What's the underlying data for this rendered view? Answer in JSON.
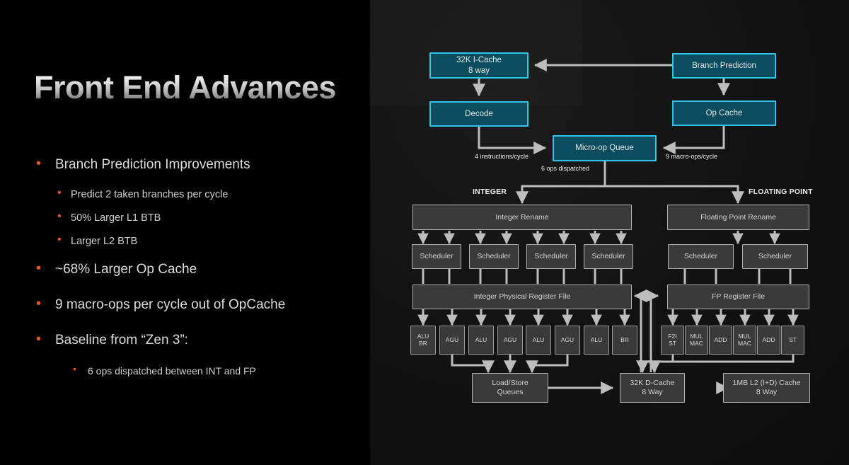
{
  "slide": {
    "title": "Front End Advances",
    "accent_orange": "#e8571f",
    "accent_cyan": "#2ec4ec",
    "panel_background": "#000000",
    "diagram_background": "#131313"
  },
  "bullets": [
    {
      "level": 1,
      "text": "Branch Prediction Improvements"
    },
    {
      "level": 2,
      "text": "Predict 2 taken branches per cycle"
    },
    {
      "level": 2,
      "text": "50% Larger L1 BTB"
    },
    {
      "level": 2,
      "text": "Larger L2 BTB"
    },
    {
      "level": 1,
      "text": "~68% Larger Op Cache"
    },
    {
      "level": 1,
      "text": "9 macro-ops per cycle out of OpCache"
    },
    {
      "level": 1,
      "text": "Baseline from “Zen 3”:"
    },
    {
      "level": 3,
      "text": "6 ops dispatched between INT and FP"
    }
  ],
  "diagram": {
    "frontend_boxes": {
      "icache_line1": "32K I-Cache",
      "icache_line2": "8 way",
      "decode": "Decode",
      "branch_prediction": "Branch Prediction",
      "op_cache": "Op Cache",
      "micro_op_queue": "Micro-op Queue"
    },
    "edge_labels": {
      "decode_rate": "4 instructions/cycle",
      "opcache_rate": "9 macro-ops/cycle",
      "dispatch_rate": "6 ops dispatched"
    },
    "section_labels": {
      "integer": "INTEGER",
      "floating_point": "FLOATING POINT"
    },
    "rename": {
      "integer": "Integer Rename",
      "floating_point": "Floating Point Rename"
    },
    "scheduler_label": "Scheduler",
    "integer_schedulers": [
      "Scheduler",
      "Scheduler",
      "Scheduler",
      "Scheduler"
    ],
    "fp_schedulers": [
      "Scheduler",
      "Scheduler"
    ],
    "register_files": {
      "integer": "Integer Physical Register File",
      "floating_point": "FP Register File"
    },
    "integer_units": [
      {
        "line1": "ALU",
        "line2": "BR"
      },
      {
        "line1": "AGU",
        "line2": ""
      },
      {
        "line1": "ALU",
        "line2": ""
      },
      {
        "line1": "AGU",
        "line2": ""
      },
      {
        "line1": "ALU",
        "line2": ""
      },
      {
        "line1": "AGU",
        "line2": ""
      },
      {
        "line1": "ALU",
        "line2": ""
      },
      {
        "line1": "BR",
        "line2": ""
      }
    ],
    "fp_units": [
      {
        "line1": "F2I",
        "line2": "ST"
      },
      {
        "line1": "MUL",
        "line2": "MAC"
      },
      {
        "line1": "ADD",
        "line2": ""
      },
      {
        "line1": "MUL",
        "line2": "MAC"
      },
      {
        "line1": "ADD",
        "line2": ""
      },
      {
        "line1": "ST",
        "line2": ""
      }
    ],
    "memory": {
      "load_store_line1": "Load/Store",
      "load_store_line2": "Queues",
      "dcache_line1": "32K D-Cache",
      "dcache_line2": "8 Way",
      "l2_line1": "1MB L2 (I+D) Cache",
      "l2_line2": "8 Way"
    }
  }
}
